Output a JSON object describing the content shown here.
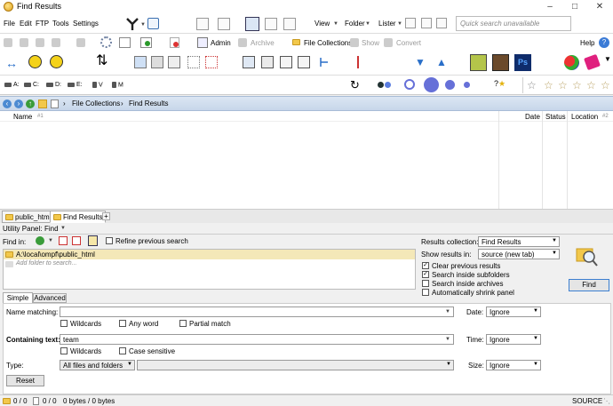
{
  "window": {
    "title": "Find Results"
  },
  "menu": {
    "file": "File",
    "edit": "Edit",
    "ftp": "FTP",
    "tools": "Tools",
    "settings": "Settings",
    "view": "View",
    "folder": "Folder",
    "lister": "Lister",
    "help": "Help"
  },
  "search": {
    "placeholder": "Quick search unavailable"
  },
  "toolbar": {
    "admin": "Admin",
    "archive": "Archive",
    "file_collections": "File Collections",
    "show": "Show",
    "convert": "Convert"
  },
  "drives": [
    "A:",
    "C:",
    "D:",
    "E:",
    "V",
    "M"
  ],
  "location": {
    "parent": "File Collections",
    "current": "Find Results"
  },
  "columns": {
    "name": "Name",
    "name_sort": "#1",
    "date": "Date",
    "status": "Status",
    "location": "Location",
    "location_sort": "#2"
  },
  "tabs": [
    {
      "label": "public_html"
    },
    {
      "label": "Find Results"
    }
  ],
  "utility": {
    "label": "Utility Panel:",
    "mode": "Find",
    "find_in_label": "Find in:",
    "refine": "Refine previous search",
    "path": "A:\\local\\ompf\\public_html",
    "add_folder": "Add folder to search...",
    "results_collection_label": "Results collection:",
    "results_collection": "Find Results",
    "show_results_label": "Show results in:",
    "show_results": "source (new tab)",
    "clear_previous": "Clear previous results",
    "search_subfolders": "Search inside subfolders",
    "search_archives": "Search inside archives",
    "auto_shrink": "Automatically shrink panel",
    "find_button": "Find",
    "tab_simple": "Simple",
    "tab_advanced": "Advanced",
    "name_matching_label": "Name matching:",
    "name_matching": "",
    "wildcards": "Wildcards",
    "any_word": "Any word",
    "partial_match": "Partial match",
    "containing_text_label": "Containing text:",
    "containing_text": "team",
    "wildcards2": "Wildcards",
    "case_sensitive": "Case sensitive",
    "type_label": "Type:",
    "type_value": "All files and folders",
    "date_label": "Date:",
    "date_value": "Ignore",
    "time_label": "Time:",
    "time_value": "Ignore",
    "size_label": "Size:",
    "size_value": "Ignore",
    "reset_button": "Reset"
  },
  "status": {
    "dirs": "0 / 0",
    "files": "0 / 0",
    "bytes": "0 bytes / 0 bytes",
    "source": "SOURCE"
  }
}
